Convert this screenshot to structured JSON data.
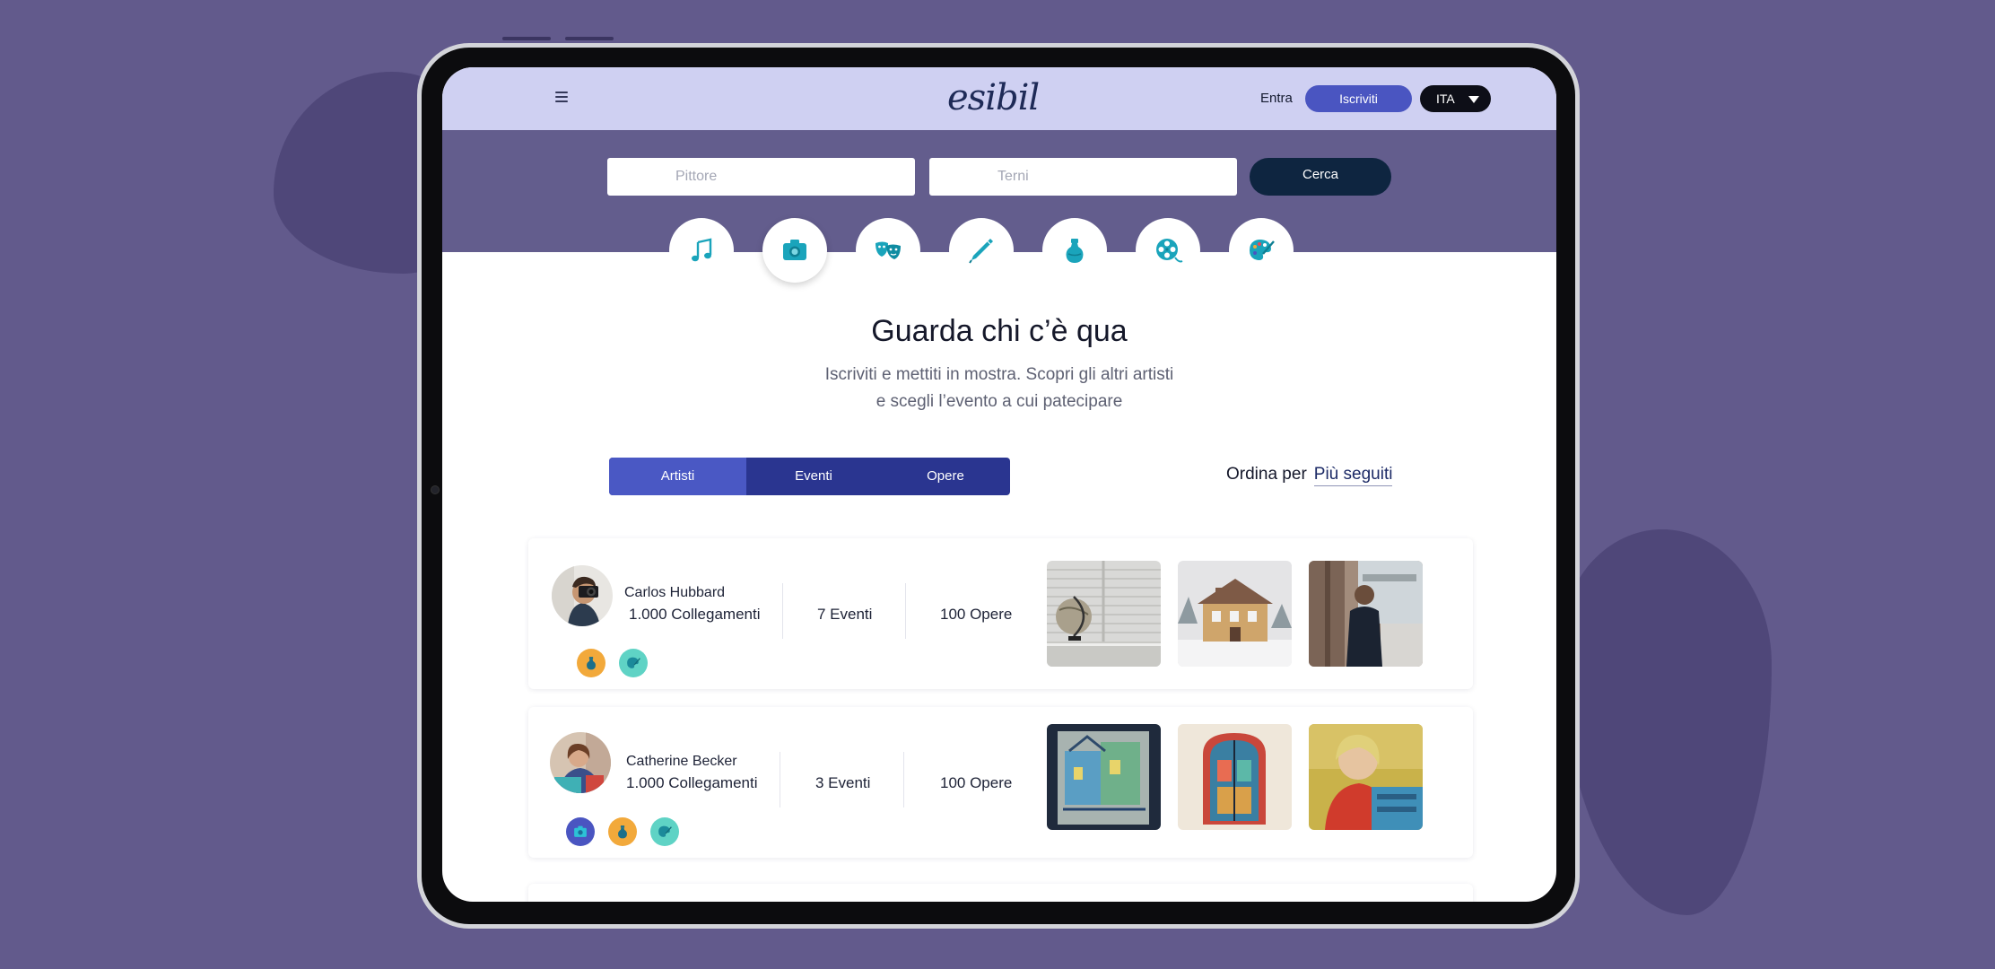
{
  "header": {
    "logo": "esibil",
    "login_label": "Entra",
    "signup_label": "Iscriviti",
    "language": "ITA"
  },
  "search": {
    "artist_placeholder": "Pittore",
    "location_placeholder": "Terni",
    "button_label": "Cerca"
  },
  "categories": [
    {
      "icon": "music-note-icon",
      "active": false
    },
    {
      "icon": "camera-icon",
      "active": true
    },
    {
      "icon": "theater-masks-icon",
      "active": false
    },
    {
      "icon": "pen-icon",
      "active": false
    },
    {
      "icon": "vase-icon",
      "active": false
    },
    {
      "icon": "film-reel-icon",
      "active": false
    },
    {
      "icon": "palette-icon",
      "active": false
    }
  ],
  "main": {
    "heading": "Guarda chi c’è qua",
    "subtitle_line1": "Iscriviti e mettiti in mostra. Scopri gli altri artisti",
    "subtitle_line2": "e scegli l’evento a cui patecipare"
  },
  "tabs": [
    {
      "label": "Artisti",
      "active": true
    },
    {
      "label": "Eventi",
      "active": false
    },
    {
      "label": "Opere",
      "active": false
    }
  ],
  "sort": {
    "label": "Ordina per",
    "value": "Più seguiti"
  },
  "artists": [
    {
      "name": "Carlos Hubbard",
      "connections": "1.000 Collegamenti",
      "events": "7 Eventi",
      "works": "100 Opere",
      "badges": [
        "vase-icon",
        "palette-icon"
      ]
    },
    {
      "name": "Catherine Becker",
      "connections": "1.000 Collegamenti",
      "events": "3 Eventi",
      "works": "100 Opere",
      "badges": [
        "camera-icon",
        "vase-icon",
        "palette-icon"
      ]
    }
  ],
  "colors": {
    "background": "#625a8c",
    "topbar": "#cfd0f2",
    "accent": "#4a55c1",
    "dark_navy": "#0e2540",
    "icon_teal": "#1aa4bb",
    "badge_orange": "#f2a93b",
    "badge_teal": "#5fd3c5",
    "badge_indigo": "#4a55c1"
  }
}
